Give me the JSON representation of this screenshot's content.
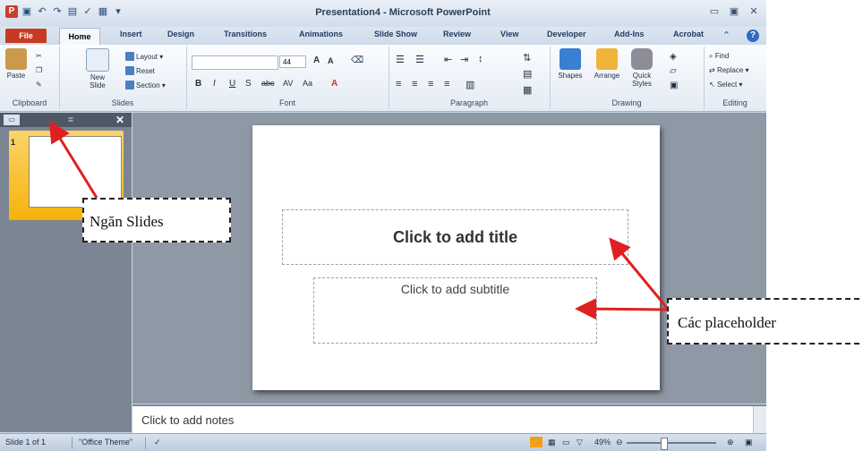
{
  "window": {
    "title": "Presentation4 - Microsoft PowerPoint",
    "app_badge": "P"
  },
  "tabs": [
    "File",
    "Home",
    "Insert",
    "Design",
    "Transitions",
    "Animations",
    "Slide Show",
    "Review",
    "View",
    "Developer",
    "Add-Ins",
    "Acrobat"
  ],
  "ribbon": {
    "clipboard": {
      "paste": "Paste",
      "label": "Clipboard"
    },
    "slides": {
      "new_slide": "New Slide",
      "layout": "Layout",
      "reset": "Reset",
      "section": "Section",
      "label": "Slides"
    },
    "font": {
      "size": "44",
      "label": "Font"
    },
    "paragraph": {
      "label": "Paragraph"
    },
    "drawing": {
      "shapes": "Shapes",
      "arrange": "Arrange",
      "quick_styles": "Quick Styles",
      "label": "Drawing"
    },
    "editing": {
      "find": "Find",
      "replace": "Replace",
      "select": "Select",
      "label": "Editing"
    }
  },
  "slides_pane": {
    "thumb_number": "1"
  },
  "slide": {
    "title_placeholder": "Click to add title",
    "subtitle_placeholder": "Click to add subtitle"
  },
  "notes": {
    "placeholder": "Click to add notes"
  },
  "status": {
    "slide_count": "Slide 1 of 1",
    "theme": "\"Office Theme\"",
    "zoom": "49%"
  },
  "annotations": {
    "slides_pane_label": "Ngăn Slides",
    "placeholder_label": "Các placeholder"
  }
}
